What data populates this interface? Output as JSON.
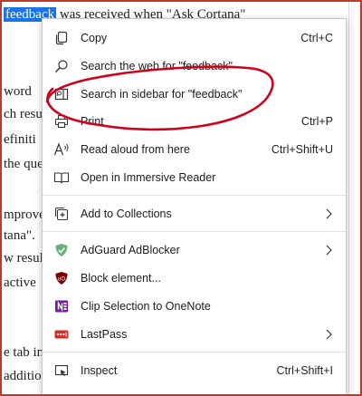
{
  "page": {
    "highlighted": "feedback",
    "line0_rest": " was received when \"Ask Cortana\"",
    "lines": [
      "word",
      "ch resul",
      "efiniti",
      "the que",
      "mprove",
      "tana\".",
      "w resul",
      "active",
      "e tab in",
      "additio"
    ]
  },
  "menu": {
    "items": [
      {
        "label": "Copy",
        "shortcut": "Ctrl+C"
      },
      {
        "label": "Search the web for \"feedback\"",
        "shortcut": ""
      },
      {
        "label": "Search in sidebar for \"feedback\"",
        "shortcut": ""
      },
      {
        "label": "Print",
        "shortcut": "Ctrl+P"
      },
      {
        "label": "Read aloud from here",
        "shortcut": "Ctrl+Shift+U"
      },
      {
        "label": "Open in Immersive Reader",
        "shortcut": ""
      },
      {
        "label": "Add to Collections",
        "shortcut": ""
      },
      {
        "label": "AdGuard AdBlocker",
        "shortcut": ""
      },
      {
        "label": "Block element...",
        "shortcut": ""
      },
      {
        "label": "Clip Selection to OneNote",
        "shortcut": ""
      },
      {
        "label": "LastPass",
        "shortcut": ""
      },
      {
        "label": "Inspect",
        "shortcut": "Ctrl+Shift+I"
      }
    ],
    "icons": [
      "copy-icon",
      "search-icon",
      "sidebar-search-icon",
      "print-icon",
      "read-aloud-icon",
      "immersive-reader-icon",
      "collections-icon",
      "adguard-icon",
      "block-element-icon",
      "onenote-icon",
      "lastpass-icon",
      "inspect-icon"
    ]
  },
  "colors": {
    "selection": "#1a73e8",
    "annotation": "#d0021b",
    "frame": "#c0392b",
    "adguard": "#67b279",
    "ublock": "#800000",
    "onenote": "#7719aa",
    "lastpass": "#d32d27"
  }
}
